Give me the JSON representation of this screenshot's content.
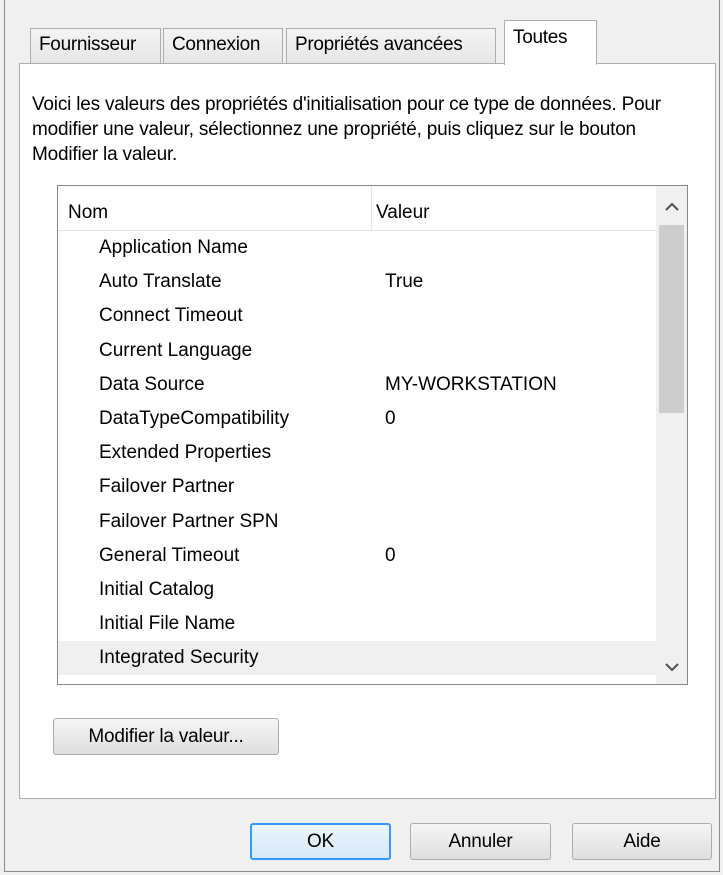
{
  "tabs": [
    "Fournisseur",
    "Connexion",
    "Propriétés avancées",
    "Toutes"
  ],
  "active_tab": "Toutes",
  "description": "Voici les valeurs des propriétés d'initialisation pour ce type de données. Pour modifier une valeur, sélectionnez une propriété, puis cliquez sur le bouton Modifier la valeur.",
  "list": {
    "col_name": "Nom",
    "col_value": "Valeur",
    "rows": [
      {
        "name": "Application Name",
        "value": ""
      },
      {
        "name": "Auto Translate",
        "value": "True"
      },
      {
        "name": "Connect Timeout",
        "value": ""
      },
      {
        "name": "Current Language",
        "value": ""
      },
      {
        "name": "Data Source",
        "value": "MY-WORKSTATION"
      },
      {
        "name": "DataTypeCompatibility",
        "value": "0"
      },
      {
        "name": "Extended Properties",
        "value": ""
      },
      {
        "name": "Failover Partner",
        "value": ""
      },
      {
        "name": "Failover Partner SPN",
        "value": ""
      },
      {
        "name": "General Timeout",
        "value": "0"
      },
      {
        "name": "Initial Catalog",
        "value": ""
      },
      {
        "name": "Initial File Name",
        "value": ""
      },
      {
        "name": "Integrated Security",
        "value": ""
      }
    ],
    "scroll_up_icon": "chevron-up-icon",
    "scroll_down_icon": "chevron-down-icon"
  },
  "buttons": {
    "modify": "Modifier la valeur...",
    "ok": "OK",
    "cancel": "Annuler",
    "help": "Aide"
  },
  "colors": {
    "accent_focus": "#3399ff",
    "panel_bg": "#ffffff",
    "dialog_bg": "#f0f0f0"
  }
}
